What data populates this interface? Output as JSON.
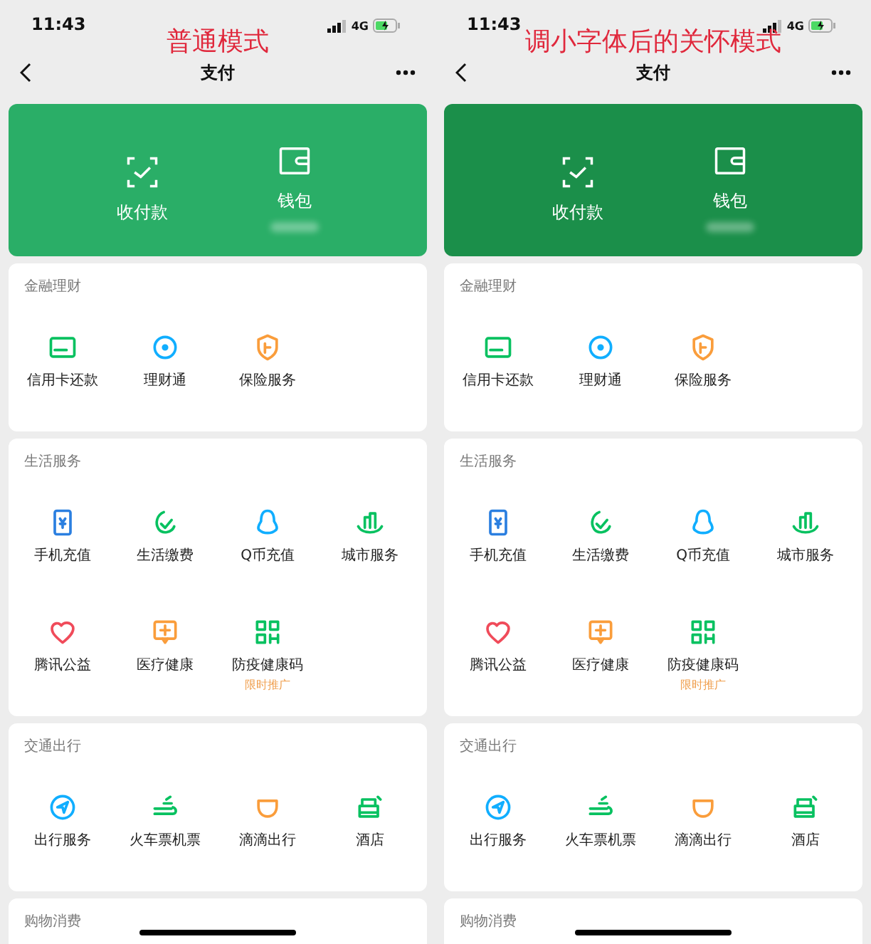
{
  "panels": [
    {
      "caption": "普通模式",
      "status_bar": {
        "time": "11:43",
        "network": "4G"
      },
      "nav": {
        "title": "支付"
      },
      "wallet_card": {
        "color": "#2aae67",
        "actions": [
          {
            "label": "收付款"
          },
          {
            "label": "钱包"
          }
        ]
      },
      "sections": [
        {
          "title": "金融理财",
          "items": [
            {
              "label": "信用卡还款"
            },
            {
              "label": "理财通"
            },
            {
              "label": "保险服务"
            }
          ]
        },
        {
          "title": "生活服务",
          "items": [
            {
              "label": "手机充值"
            },
            {
              "label": "生活缴费"
            },
            {
              "label": "Q币充值"
            },
            {
              "label": "城市服务"
            },
            {
              "label": "腾讯公益"
            },
            {
              "label": "医疗健康"
            },
            {
              "label": "防疫健康码",
              "tag": "限时推广"
            }
          ]
        },
        {
          "title": "交通出行",
          "items": [
            {
              "label": "出行服务"
            },
            {
              "label": "火车票机票"
            },
            {
              "label": "滴滴出行"
            },
            {
              "label": "酒店"
            }
          ]
        },
        {
          "title": "购物消费"
        }
      ]
    },
    {
      "caption": "调小字体后的关怀模式",
      "status_bar": {
        "time": "11:43",
        "network": "4G"
      },
      "nav": {
        "title": "支付"
      },
      "wallet_card": {
        "color": "#1b8f4a",
        "actions": [
          {
            "label": "收付款"
          },
          {
            "label": "钱包"
          }
        ]
      },
      "sections": [
        {
          "title": "金融理财",
          "items": [
            {
              "label": "信用卡还款"
            },
            {
              "label": "理财通"
            },
            {
              "label": "保险服务"
            }
          ]
        },
        {
          "title": "生活服务",
          "items": [
            {
              "label": "手机充值"
            },
            {
              "label": "生活缴费"
            },
            {
              "label": "Q币充值"
            },
            {
              "label": "城市服务"
            },
            {
              "label": "腾讯公益"
            },
            {
              "label": "医疗健康"
            },
            {
              "label": "防疫健康码",
              "tag": "限时推广"
            }
          ]
        },
        {
          "title": "交通出行",
          "items": [
            {
              "label": "出行服务"
            },
            {
              "label": "火车票机票"
            },
            {
              "label": "滴滴出行"
            },
            {
              "label": "酒店"
            }
          ]
        },
        {
          "title": "购物消费"
        }
      ]
    }
  ]
}
